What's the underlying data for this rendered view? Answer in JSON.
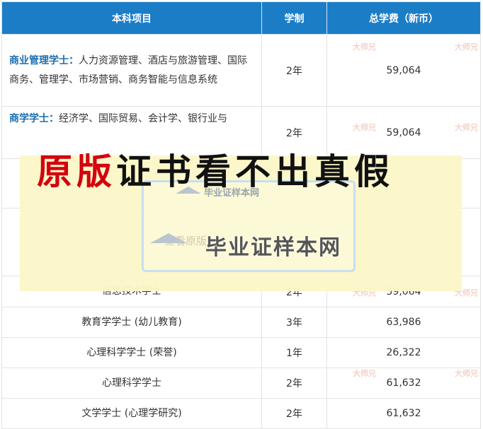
{
  "table": {
    "headers": [
      "本科项目",
      "学制",
      "总学费（新币）"
    ],
    "rows": [
      {
        "category": "商业管理学士：",
        "program": "人力资源管理、酒店与旅游管理、国际商务、管理学、市场营销、商务智能与信息系统",
        "years": "2年",
        "fee": "59,064"
      },
      {
        "category": "商学学士：",
        "program": "经济学、国际贸易、会计学、银行业与",
        "years": "2年",
        "fee": "59,064"
      },
      {
        "category": "",
        "program": "",
        "years": "",
        "fee": ""
      },
      {
        "category": "",
        "program": "",
        "years": "",
        "fee": ""
      },
      {
        "category": "",
        "program": "信息技术学士",
        "years": "2年",
        "fee": "59,064"
      },
      {
        "category": "",
        "program": "教育学学士 (幼儿教育)",
        "years": "3年",
        "fee": "63,986"
      },
      {
        "category": "",
        "program": "心理科学学士 (荣誉)",
        "years": "1年",
        "fee": "26,322"
      },
      {
        "category": "",
        "program": "心理科学学士",
        "years": "2年",
        "fee": "61,632"
      },
      {
        "category": "",
        "program": "文学学士 (心理学研究)",
        "years": "2年",
        "fee": "61,632"
      }
    ]
  },
  "overlay": {
    "headline_red": "原版",
    "headline_dark": "证书看不出真假",
    "stamp_small": "毕业证样本网",
    "stamp_large": "毕业证样本网",
    "stamp_ghost": "查看原版"
  },
  "watermark": {
    "text": "大师兄"
  },
  "colors": {
    "header": "#1c7dc7",
    "category": "#1a6fb0",
    "headline_red": "#d3000e",
    "band": "#fbf7c8"
  }
}
